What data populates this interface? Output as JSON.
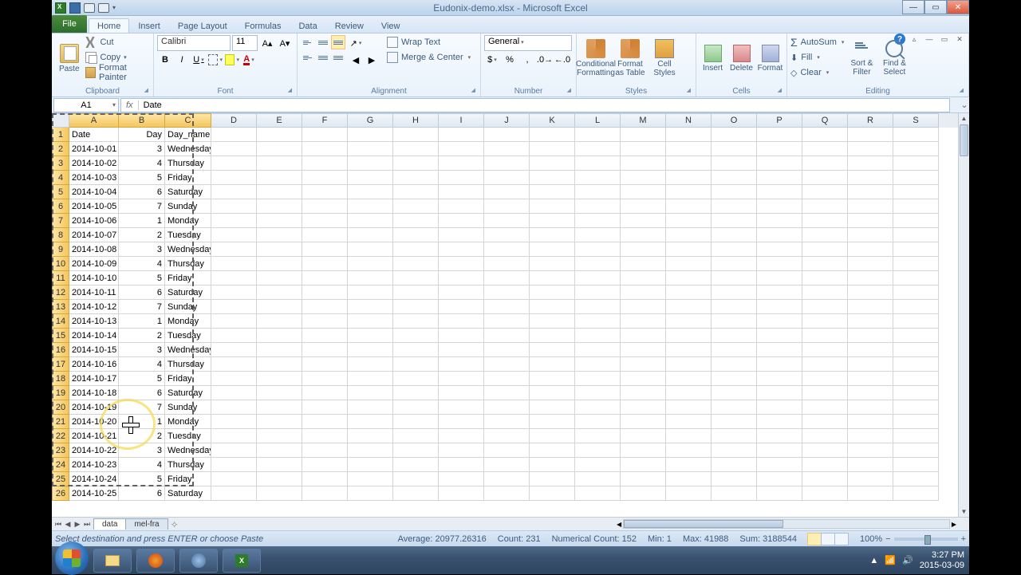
{
  "window": {
    "title": "Eudonix-demo.xlsx - Microsoft Excel"
  },
  "tabs": {
    "file": "File",
    "home": "Home",
    "insert": "Insert",
    "pagelayout": "Page Layout",
    "formulas": "Formulas",
    "data": "Data",
    "review": "Review",
    "view": "View"
  },
  "ribbon": {
    "clipboard": {
      "label": "Clipboard",
      "paste": "Paste",
      "cut": "Cut",
      "copy": "Copy",
      "fmtpainter": "Format Painter"
    },
    "font": {
      "label": "Font",
      "name": "Calibri",
      "size": "11"
    },
    "alignment": {
      "label": "Alignment",
      "wrap": "Wrap Text",
      "merge": "Merge & Center"
    },
    "number": {
      "label": "Number",
      "format": "General"
    },
    "styles": {
      "label": "Styles",
      "cond": "Conditional Formatting",
      "fmttbl": "Format as Table",
      "cellsty": "Cell Styles"
    },
    "cells": {
      "label": "Cells",
      "insert": "Insert",
      "delete": "Delete",
      "format": "Format"
    },
    "editing": {
      "label": "Editing",
      "autosum": "AutoSum",
      "fill": "Fill",
      "clear": "Clear",
      "sort": "Sort & Filter",
      "find": "Find & Select"
    }
  },
  "namebox": "A1",
  "formula": "Date",
  "columns": [
    "A",
    "B",
    "C",
    "D",
    "E",
    "F",
    "G",
    "H",
    "I",
    "J",
    "K",
    "L",
    "M",
    "N",
    "O",
    "P",
    "Q",
    "R",
    "S"
  ],
  "headers": {
    "A": "Date",
    "B": "Day",
    "C": "Day_name"
  },
  "rows": [
    {
      "n": 1,
      "A": "Date",
      "B": "Day",
      "C": "Day_name"
    },
    {
      "n": 2,
      "A": "2014-10-01",
      "B": "3",
      "C": "Wednesday"
    },
    {
      "n": 3,
      "A": "2014-10-02",
      "B": "4",
      "C": "Thursday"
    },
    {
      "n": 4,
      "A": "2014-10-03",
      "B": "5",
      "C": "Friday"
    },
    {
      "n": 5,
      "A": "2014-10-04",
      "B": "6",
      "C": "Saturday"
    },
    {
      "n": 6,
      "A": "2014-10-05",
      "B": "7",
      "C": "Sunday"
    },
    {
      "n": 7,
      "A": "2014-10-06",
      "B": "1",
      "C": "Monday"
    },
    {
      "n": 8,
      "A": "2014-10-07",
      "B": "2",
      "C": "Tuesday"
    },
    {
      "n": 9,
      "A": "2014-10-08",
      "B": "3",
      "C": "Wednesday"
    },
    {
      "n": 10,
      "A": "2014-10-09",
      "B": "4",
      "C": "Thursday"
    },
    {
      "n": 11,
      "A": "2014-10-10",
      "B": "5",
      "C": "Friday"
    },
    {
      "n": 12,
      "A": "2014-10-11",
      "B": "6",
      "C": "Saturday"
    },
    {
      "n": 13,
      "A": "2014-10-12",
      "B": "7",
      "C": "Sunday"
    },
    {
      "n": 14,
      "A": "2014-10-13",
      "B": "1",
      "C": "Monday"
    },
    {
      "n": 15,
      "A": "2014-10-14",
      "B": "2",
      "C": "Tuesday"
    },
    {
      "n": 16,
      "A": "2014-10-15",
      "B": "3",
      "C": "Wednesday"
    },
    {
      "n": 17,
      "A": "2014-10-16",
      "B": "4",
      "C": "Thursday"
    },
    {
      "n": 18,
      "A": "2014-10-17",
      "B": "5",
      "C": "Friday"
    },
    {
      "n": 19,
      "A": "2014-10-18",
      "B": "6",
      "C": "Saturday"
    },
    {
      "n": 20,
      "A": "2014-10-19",
      "B": "7",
      "C": "Sunday"
    },
    {
      "n": 21,
      "A": "2014-10-20",
      "B": "1",
      "C": "Monday"
    },
    {
      "n": 22,
      "A": "2014-10-21",
      "B": "2",
      "C": "Tuesday"
    },
    {
      "n": 23,
      "A": "2014-10-22",
      "B": "3",
      "C": "Wednesday"
    },
    {
      "n": 24,
      "A": "2014-10-23",
      "B": "4",
      "C": "Thursday"
    },
    {
      "n": 25,
      "A": "2014-10-24",
      "B": "5",
      "C": "Friday"
    },
    {
      "n": 26,
      "A": "2014-10-25",
      "B": "6",
      "C": "Saturday"
    }
  ],
  "sheets": {
    "active": "data",
    "other": "mel-fra"
  },
  "status": {
    "msg": "Select destination and press ENTER or choose Paste",
    "avg": "Average: 20977.26316",
    "count": "Count: 231",
    "numcount": "Numerical Count: 152",
    "min": "Min: 1",
    "max": "Max: 41988",
    "sum": "Sum: 3188544",
    "zoom": "100%"
  },
  "taskbar": {
    "time": "3:27 PM",
    "date": "2015-03-09"
  }
}
